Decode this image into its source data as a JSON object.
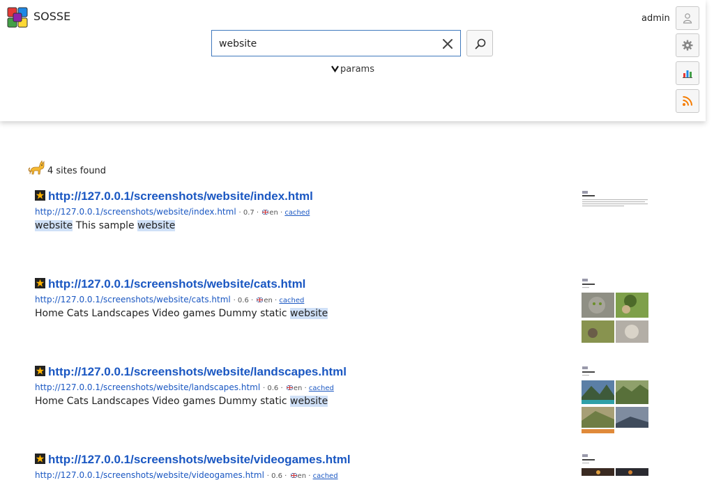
{
  "header": {
    "app_title": "SOSSE",
    "user_name": "admin",
    "params_label": "params"
  },
  "search": {
    "query": "website"
  },
  "results_summary": "4 sites found",
  "results": [
    {
      "title": "http://127.0.0.1/screenshots/website/index.html",
      "url": "http://127.0.0.1/screenshots/website/index.html",
      "score": "0.7",
      "lang": "en",
      "cached_label": "cached",
      "snippet": [
        {
          "text": "website",
          "hl": true
        },
        {
          "text": " This sample ",
          "hl": false
        },
        {
          "text": "website",
          "hl": true
        }
      ]
    },
    {
      "title": "http://127.0.0.1/screenshots/website/cats.html",
      "url": "http://127.0.0.1/screenshots/website/cats.html",
      "score": "0.6",
      "lang": "en",
      "cached_label": "cached",
      "snippet": [
        {
          "text": "Home Cats Landscapes Video games Dummy static ",
          "hl": false
        },
        {
          "text": "website",
          "hl": true
        }
      ]
    },
    {
      "title": "http://127.0.0.1/screenshots/website/landscapes.html",
      "url": "http://127.0.0.1/screenshots/website/landscapes.html",
      "score": "0.6",
      "lang": "en",
      "cached_label": "cached",
      "snippet": [
        {
          "text": "Home Cats Landscapes Video games Dummy static ",
          "hl": false
        },
        {
          "text": "website",
          "hl": true
        }
      ]
    },
    {
      "title": "http://127.0.0.1/screenshots/website/videogames.html",
      "url": "http://127.0.0.1/screenshots/website/videogames.html",
      "score": "0.6",
      "lang": "en",
      "cached_label": "cached",
      "snippet": []
    }
  ],
  "colors": {
    "link": "#1a57c2",
    "highlight": "#cfe0f7",
    "search_border": "#3f78bd"
  },
  "icons": {
    "logo": "sosse-logo-icon",
    "clear": "close-icon",
    "search": "search-icon",
    "params": "chevron-down-icon",
    "user": "user-icon",
    "settings": "gear-icon",
    "stats": "bar-chart-icon",
    "rss": "rss-icon",
    "results": "cat-icon",
    "favicon": "star-favicon-icon",
    "flag": "uk-flag-icon"
  }
}
